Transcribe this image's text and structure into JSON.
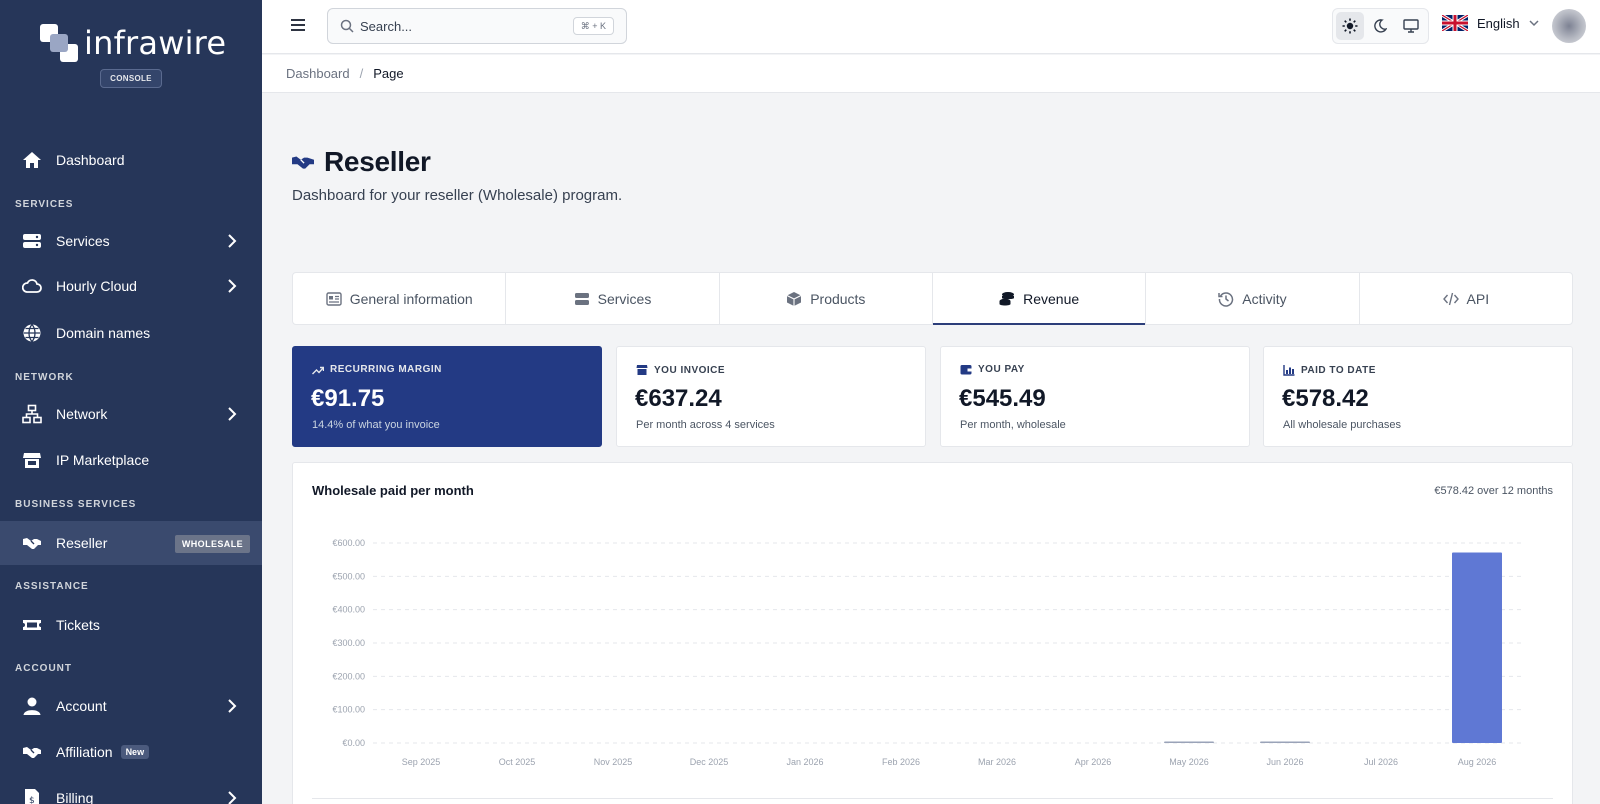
{
  "brand": {
    "name": "infrawire",
    "badge": "CONSOLE"
  },
  "sidebar": {
    "items": [
      {
        "id": "dashboard",
        "label": "Dashboard",
        "icon": "home-icon"
      },
      {
        "id": "services",
        "label": "Services",
        "icon": "server-icon"
      },
      {
        "id": "hourly-cloud",
        "label": "Hourly Cloud",
        "icon": "cloud-icon"
      },
      {
        "id": "domain-names",
        "label": "Domain names",
        "icon": "globe-icon"
      },
      {
        "id": "network",
        "label": "Network",
        "icon": "network-icon"
      },
      {
        "id": "ip-marketplace",
        "label": "IP Marketplace",
        "icon": "store-icon"
      },
      {
        "id": "reseller",
        "label": "Reseller",
        "icon": "handshake-icon",
        "badge": "WHOLESALE"
      },
      {
        "id": "tickets",
        "label": "Tickets",
        "icon": "ticket-icon"
      },
      {
        "id": "account",
        "label": "Account",
        "icon": "user-icon"
      },
      {
        "id": "affiliation",
        "label": "Affiliation",
        "icon": "handshake-icon",
        "badge": "New"
      },
      {
        "id": "billing",
        "label": "Billing",
        "icon": "receipt-icon"
      }
    ],
    "sections": {
      "services": "SERVICES",
      "network": "NETWORK",
      "business": "BUSINESS SERVICES",
      "assistance": "ASSISTANCE",
      "account": "ACCOUNT"
    }
  },
  "header": {
    "search_placeholder": "Search...",
    "search_shortcut": "⌘ + K",
    "language": "English"
  },
  "breadcrumb": [
    "Dashboard",
    "Page"
  ],
  "page": {
    "title": "Reseller",
    "subtitle": "Dashboard for your reseller (Wholesale) program."
  },
  "tabs": [
    {
      "label": "General information",
      "icon": "id-card-icon"
    },
    {
      "label": "Services",
      "icon": "server-icon"
    },
    {
      "label": "Products",
      "icon": "box-icon"
    },
    {
      "label": "Revenue",
      "icon": "coins-icon",
      "active": true
    },
    {
      "label": "Activity",
      "icon": "history-icon"
    },
    {
      "label": "API",
      "icon": "code-icon"
    }
  ],
  "stats": [
    {
      "label": "RECURRING MARGIN",
      "value": "€91.75",
      "note": "14.4% of what you invoice",
      "icon": "trend-up-icon"
    },
    {
      "label": "YOU INVOICE",
      "value": "€637.24",
      "note": "Per month across 4 services",
      "icon": "store-icon"
    },
    {
      "label": "YOU PAY",
      "value": "€545.49",
      "note": "Per month, wholesale",
      "icon": "wallet-icon"
    },
    {
      "label": "PAID TO DATE",
      "value": "€578.42",
      "note": "All wholesale purchases",
      "icon": "chart-icon"
    }
  ],
  "colors": {
    "sidebar": "#263659",
    "accent": "#233a84",
    "bar": "#5f78d4"
  },
  "chart_data": {
    "type": "bar",
    "title": "Wholesale paid per month",
    "summary": "€578.42 over 12 months",
    "categories": [
      "Sep 2025",
      "Oct 2025",
      "Nov 2025",
      "Dec 2025",
      "Jan 2026",
      "Feb 2026",
      "Mar 2026",
      "Apr 2026",
      "May 2026",
      "Jun 2026",
      "Jul 2026",
      "Aug 2026"
    ],
    "values": [
      0,
      0,
      0,
      0,
      0,
      0,
      0,
      0,
      4.5,
      2.5,
      0,
      571.42
    ],
    "ylim": [
      0,
      600
    ],
    "yticks": [
      "€0.00",
      "€100.00",
      "€200.00",
      "€300.00",
      "€400.00",
      "€500.00",
      "€600.00"
    ],
    "ytick_values": [
      0,
      100,
      200,
      300,
      400,
      500,
      600
    ],
    "grid": true
  }
}
